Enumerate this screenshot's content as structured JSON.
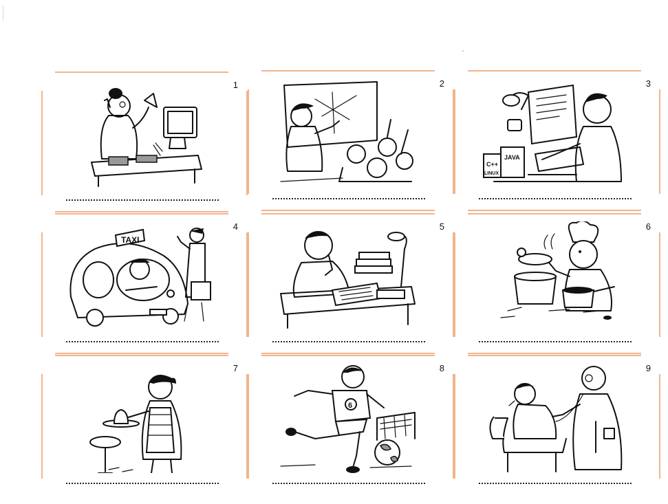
{
  "cards": [
    {
      "number": "1",
      "illustration": "secretary on phone at computer desk"
    },
    {
      "number": "2",
      "illustration": "teacher at blackboard with pupils"
    },
    {
      "number": "3",
      "illustration": "programmer at computer"
    },
    {
      "number": "4",
      "illustration": "taxi driver and passenger with suitcase"
    },
    {
      "number": "5",
      "illustration": "student studying at desk with books"
    },
    {
      "number": "6",
      "illustration": "chef cooking with pots"
    },
    {
      "number": "7",
      "illustration": "waitress carrying a tray"
    },
    {
      "number": "8",
      "illustration": "footballer kicking a ball"
    },
    {
      "number": "9",
      "illustration": "doctor examining a patient"
    }
  ],
  "labels": {
    "taxi": "TAXI",
    "java": "JAVA",
    "cpp": "C++",
    "linux": "LINUX",
    "shirt_number": "6"
  },
  "colors": {
    "frame": "#f2b48c",
    "ink": "#111111"
  }
}
